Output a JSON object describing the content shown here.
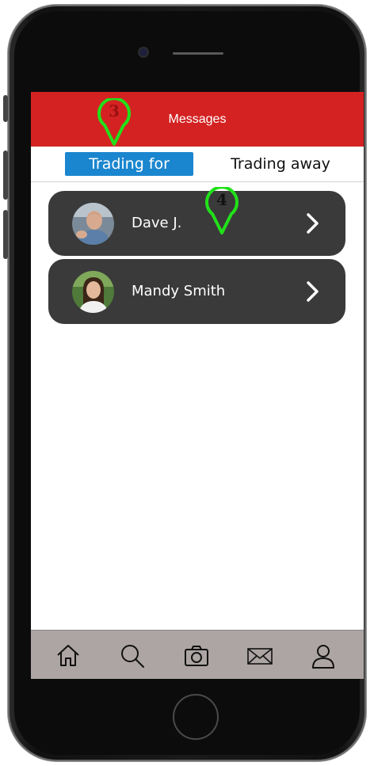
{
  "header": {
    "title": "Messages"
  },
  "tabs": {
    "active_label": "Trading for",
    "inactive_label": "Trading away"
  },
  "conversations": [
    {
      "name": "Dave J."
    },
    {
      "name": "Mandy Smith"
    }
  ],
  "markers": [
    {
      "label": "3",
      "label_color": "#9a1010"
    },
    {
      "label": "4",
      "label_color": "#111111"
    }
  ],
  "tabbar_icons": [
    "home-icon",
    "search-icon",
    "camera-icon",
    "mail-icon",
    "profile-icon"
  ],
  "colors": {
    "header_red": "#d42222",
    "tab_blue": "#1a86cf",
    "card_dark": "#3a3a3a",
    "tabbar_gray": "#ada5a4",
    "marker_green": "#22e01a"
  }
}
